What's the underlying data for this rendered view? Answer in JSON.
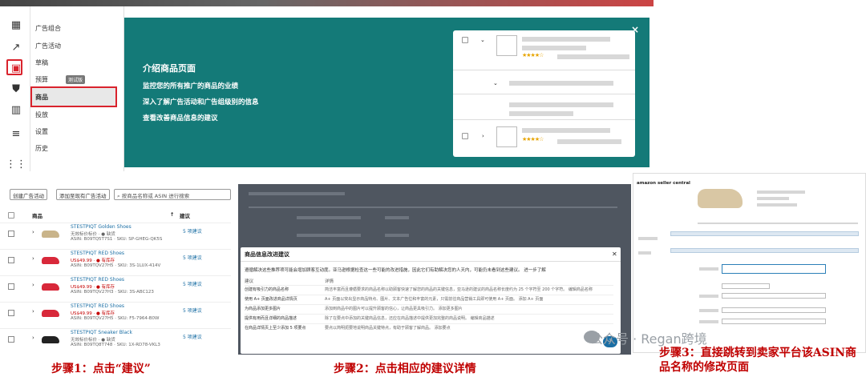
{
  "nav": {
    "items": [
      {
        "label": "广告组合"
      },
      {
        "label": "广告活动"
      },
      {
        "label": "草稿"
      },
      {
        "label": "预算",
        "badge": "测试版"
      },
      {
        "label": "商品"
      },
      {
        "label": "投放"
      },
      {
        "label": "设置"
      },
      {
        "label": "历史"
      }
    ],
    "icons": [
      "dashboard-icon",
      "trend-icon",
      "wallet-icon",
      "shield-icon",
      "bar-chart-icon",
      "grid-icon"
    ]
  },
  "promo": {
    "title": "介绍商品页面",
    "lines": [
      "监控您的所有推广的商品的业绩",
      "深入了解广告活动和广告组级别的信息",
      "查看改善商品信息的建议"
    ],
    "close": "×",
    "stars": "★★★★☆"
  },
  "list": {
    "create_btn": "创建广告活动",
    "add_btn": "添加至现有广告活动",
    "search_placeholder": "按商品名称或 ASIN 进行搜索",
    "col_product": "商品",
    "col_suggestion": "建议",
    "rows": [
      {
        "title": "STESTPIQT Golden Shoes",
        "sub1": "无效标价标价 · ● 缺货",
        "price": "",
        "sub2": "ASIN: B09TQ5T7S1 · SKU: SP-GHEG-QK5S",
        "sug": "5 项建议",
        "color": "#c9b48a"
      },
      {
        "title": "STESTPIQT RED Shoes",
        "sub1": "US$49.99 · ● 有库存",
        "price": "US$49.99",
        "sub2": "ASIN: B09TQV27H5 · SKU: 3S-1LUX-414V",
        "sug": "5 项建议",
        "color": "#d8283a"
      },
      {
        "title": "STESTPIQT RED Shoes",
        "sub1": "US$49.99 · ● 有库存",
        "price": "US$49.99",
        "sub2": "ASIN: B09TQV27H3 · SKU: 3S-ABC123",
        "sug": "5 项建议",
        "color": "#d8283a"
      },
      {
        "title": "STESTPIQT RED Shoes",
        "sub1": "US$49.99 · ● 有库存",
        "price": "US$49.99",
        "sub2": "ASIN: B09TQV27H5 · SKU: F5-7964-B0W",
        "sug": "5 项建议",
        "color": "#d8283a"
      },
      {
        "title": "STESTPIQT Sneaker Black",
        "sub1": "无效标价标价 · ● 缺货",
        "price": "",
        "sub2": "ASIN: B09TQ8T748 · SKU: 1X-RD78-VKL3",
        "sug": "5 项建议",
        "color": "#222222"
      }
    ]
  },
  "dialog": {
    "title": "商品信息改进建议",
    "intro": "遵循解决这些推荐项可能会增加顾客互动度。亚马逊根据检查这一些可能的改进措施，因此它们有助解决您的人天内，可能仍未看到这些建议。 进一步了解",
    "col_a": "建议",
    "col_b": "详情",
    "rows": [
      {
        "a": "创建有吸引力的商品名称",
        "b": "简洁丰富而且遵循要求的商品名称以助顾客快速了解您的商品的关键信息，亚马逊的建议的商品名称长度约为 25 个字符至 200 个字符。 编辑商品名称"
      },
      {
        "a": "使用 A+ 页面改进商品详情页",
        "b": "A+ 页面以突出显示商品特点、图片、文本广告位和丰富的元素，只需前往商品营销工具即可使用 A+ 页面。 添加 A+ 页面"
      },
      {
        "a": "为商品添加更多图片",
        "b": "添加到商品中的图片可以提升顾客的信心，让商品更具吸引力。 添加更多图片"
      },
      {
        "a": "提供有用而且详细的商品描述",
        "b": "除了在要点中添加的关键商品信息，还应在商品描述中提供更加完整的商品说明。 编辑商品描述"
      },
      {
        "a": "在商品详情页上至少添加 5 项要点",
        "b": "要点以简明扼要地说明商品关键特点，有助于顾客了解商品。 添加要点"
      }
    ]
  },
  "right": {
    "brand": "amazon seller central"
  },
  "captions": {
    "step1": "步骤1：点击“建议”",
    "step2": "步骤2：点击相应的建议详情",
    "step3": "步骤3：直接跳转到卖家平台该ASIN商品名称的修改页面",
    "watermark": "公众号 · Regan跨境"
  }
}
